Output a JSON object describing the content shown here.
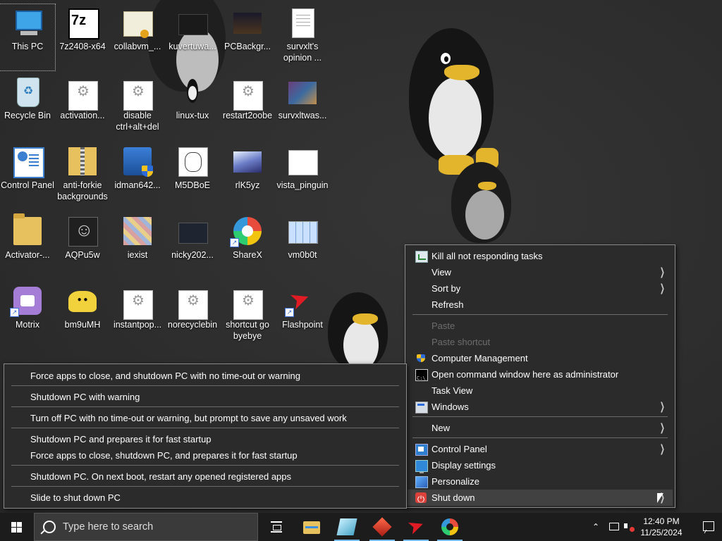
{
  "desktop": {
    "icons": [
      {
        "label": "This PC",
        "type": "pc"
      },
      {
        "label": "7z2408-x64",
        "type": "sevenz"
      },
      {
        "label": "collabvm_...",
        "type": "cert"
      },
      {
        "label": "kuvertuwa...",
        "type": "dark"
      },
      {
        "label": "PCBackgr...",
        "type": "bg"
      },
      {
        "label": "survxlt's opinion ...",
        "type": "doc"
      },
      {
        "label": "Recycle Bin",
        "type": "bin"
      },
      {
        "label": "activation...",
        "type": "gear"
      },
      {
        "label": "disable ctrl+alt+del",
        "type": "gear"
      },
      {
        "label": "linux-tux",
        "type": "tux"
      },
      {
        "label": "restart2oobe",
        "type": "gear"
      },
      {
        "label": "survxltwas...",
        "type": "photo"
      },
      {
        "label": "Control Panel",
        "type": "cp"
      },
      {
        "label": "anti-forkie backgrounds",
        "type": "zip"
      },
      {
        "label": "idman642...",
        "type": "shield"
      },
      {
        "label": "M5DBoE",
        "type": "sketch"
      },
      {
        "label": "rlK5yz",
        "type": "shot"
      },
      {
        "label": "vista_pinguin",
        "type": "page"
      },
      {
        "label": "Activator-...",
        "type": "folder"
      },
      {
        "label": "AQPu5w",
        "type": "blackart"
      },
      {
        "label": "iexist",
        "type": "collage"
      },
      {
        "label": "nicky202...",
        "type": "dark2"
      },
      {
        "label": "ShareX",
        "type": "sharex"
      },
      {
        "label": "vm0b0t",
        "type": "grid"
      },
      {
        "label": "Motrix",
        "type": "motrix"
      },
      {
        "label": "bm9uMH",
        "type": "mask"
      },
      {
        "label": "instantpop...",
        "type": "gear"
      },
      {
        "label": "norecyclebin",
        "type": "gear"
      },
      {
        "label": "shortcut go byebye",
        "type": "gear"
      },
      {
        "label": "Flashpoint",
        "type": "flash"
      }
    ]
  },
  "context_menu": {
    "items": [
      {
        "label": "Kill all not responding tasks",
        "icon": "kill-icon"
      },
      {
        "label": "View",
        "submenu": true
      },
      {
        "label": "Sort by",
        "submenu": true
      },
      {
        "label": "Refresh"
      },
      {
        "label": "Paste",
        "disabled": true
      },
      {
        "label": "Paste shortcut",
        "disabled": true
      },
      {
        "label": "Computer Management",
        "icon": "computer-management-icon"
      },
      {
        "label": "Open command window here as administrator",
        "icon": "cmd-icon"
      },
      {
        "label": "Task View"
      },
      {
        "label": "Windows",
        "icon": "windows-icon",
        "submenu": true
      },
      {
        "label": "New",
        "submenu": true
      },
      {
        "label": "Control Panel",
        "icon": "control-panel-icon",
        "submenu": true
      },
      {
        "label": "Display settings",
        "icon": "display-icon"
      },
      {
        "label": "Personalize",
        "icon": "personalize-icon"
      },
      {
        "label": "Shut down",
        "icon": "power-icon",
        "submenu": true,
        "hover": true
      }
    ]
  },
  "shutdown_menu": {
    "items": [
      "Force apps to close, and shutdown PC with no time-out or warning",
      "Shutdown PC with warning",
      "Turn off PC with no time-out or warning, but prompt to save any unsaved work",
      "Shutdown PC and prepares it for fast startup",
      "Force apps to close, shutdown PC, and prepares it for fast startup",
      "Shutdown PC. On next boot, restart any opened registered apps",
      "Slide to shut down PC"
    ]
  },
  "taskbar": {
    "search_placeholder": "Type here to search",
    "apps": [
      "task-view-icon",
      "file-explorer-icon",
      "notepad-icon",
      "red-app-icon",
      "flashpoint-icon",
      "sharex-icon"
    ],
    "clock_time": "12:40 PM",
    "clock_date": "11/25/2024"
  },
  "colors": {
    "taskbar": "#1c1c1c",
    "menu_bg": "#2b2b2b",
    "menu_hover": "#414141",
    "accent": "#76b9ed"
  }
}
